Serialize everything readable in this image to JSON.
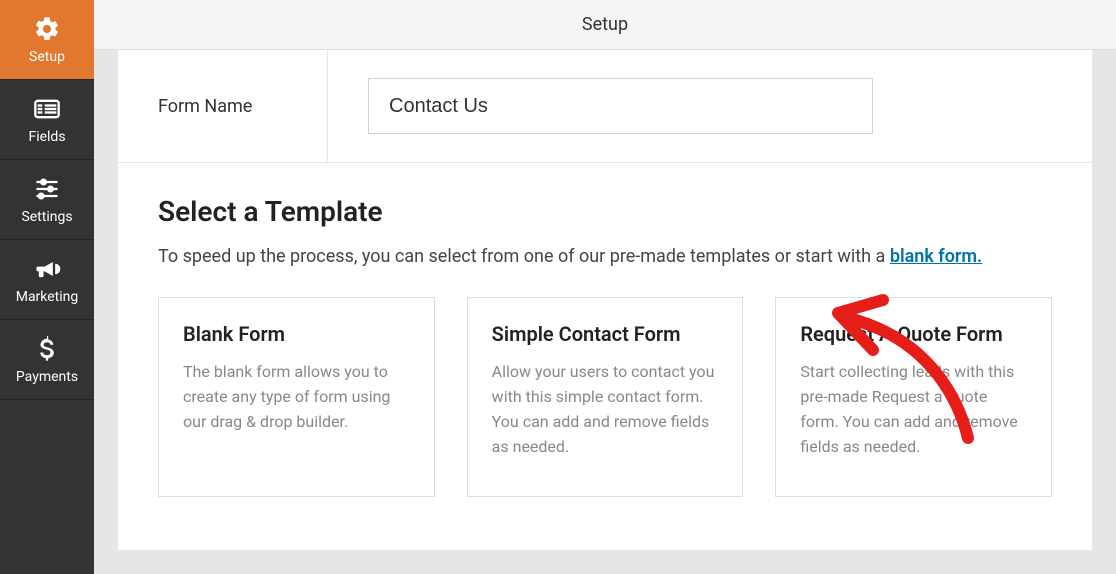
{
  "sidebar": {
    "items": [
      {
        "id": "setup",
        "label": "Setup",
        "icon": "gear-icon",
        "active": true
      },
      {
        "id": "fields",
        "label": "Fields",
        "icon": "list-icon",
        "active": false
      },
      {
        "id": "settings",
        "label": "Settings",
        "icon": "sliders-icon",
        "active": false
      },
      {
        "id": "marketing",
        "label": "Marketing",
        "icon": "bullhorn-icon",
        "active": false
      },
      {
        "id": "payments",
        "label": "Payments",
        "icon": "dollar-icon",
        "active": false
      }
    ]
  },
  "header": {
    "title": "Setup"
  },
  "form": {
    "name_label": "Form Name",
    "name_value": "Contact Us"
  },
  "section": {
    "heading": "Select a Template",
    "lead_text": "To speed up the process, you can select from one of our pre-made templates or start with a ",
    "lead_link_text": "blank form."
  },
  "templates": [
    {
      "title": "Blank Form",
      "desc": "The blank form allows you to create any type of form using our drag & drop builder."
    },
    {
      "title": "Simple Contact Form",
      "desc": "Allow your users to contact you with this simple contact form. You can add and remove fields as needed."
    },
    {
      "title": "Request A Quote Form",
      "desc": "Start collecting leads with this pre-made Request a quote form. You can add and remove fields as needed."
    }
  ]
}
